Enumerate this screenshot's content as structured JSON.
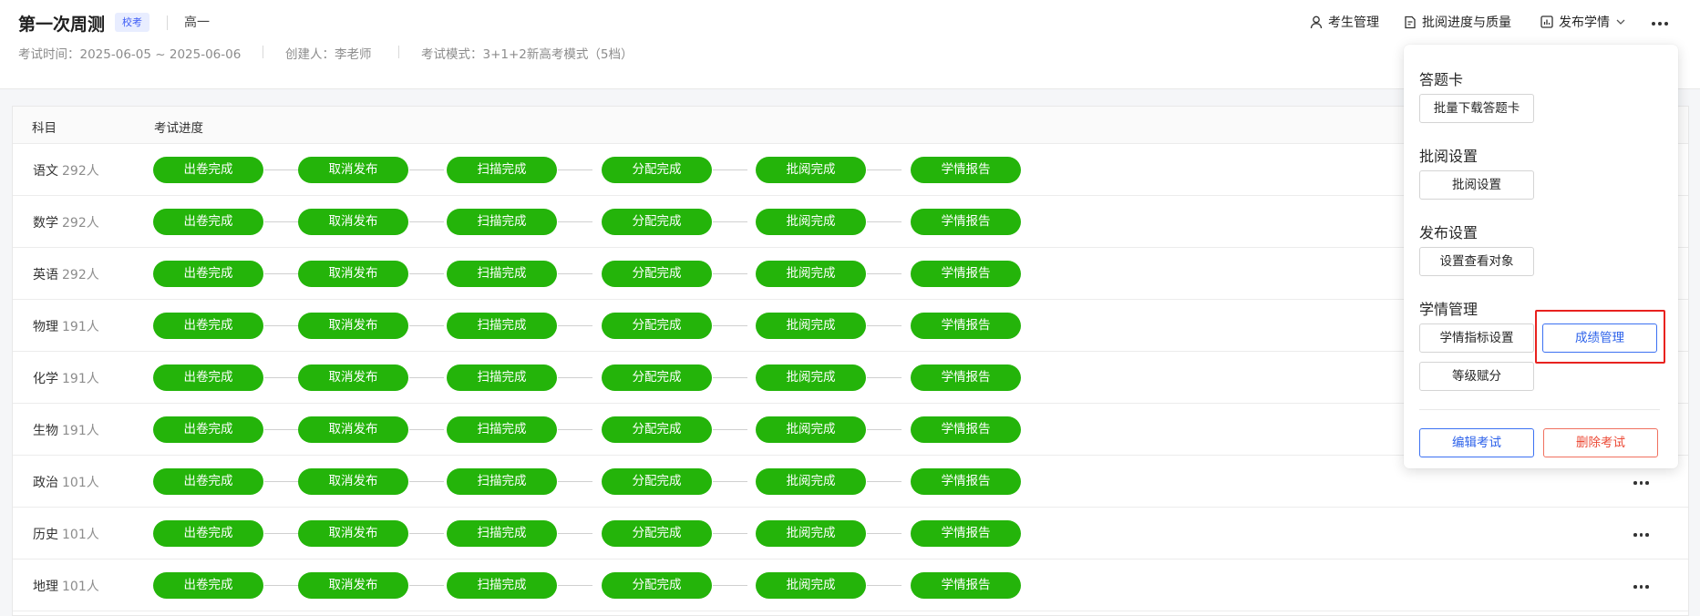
{
  "header": {
    "title": "第一次周测",
    "tag": "校考",
    "grade": "高一",
    "meta": {
      "exam_time": "考试时间：2025-06-05 ~ 2025-06-06",
      "creator": "创建人：李老师",
      "mode": "考试模式：3+1+2新高考模式（5档）"
    },
    "actions": {
      "student_mgmt": "考生管理",
      "review_progress": "批阅进度与质量",
      "publish_report": "发布学情"
    }
  },
  "table": {
    "columns": {
      "subject": "科目",
      "progress": "考试进度"
    },
    "stages": [
      "出卷完成",
      "取消发布",
      "扫描完成",
      "分配完成",
      "批阅完成",
      "学情报告"
    ],
    "rows": [
      {
        "subject": "语文",
        "count": "292人"
      },
      {
        "subject": "数学",
        "count": "292人"
      },
      {
        "subject": "英语",
        "count": "292人"
      },
      {
        "subject": "物理",
        "count": "191人"
      },
      {
        "subject": "化学",
        "count": "191人"
      },
      {
        "subject": "生物",
        "count": "191人"
      },
      {
        "subject": "政治",
        "count": "101人"
      },
      {
        "subject": "历史",
        "count": "101人"
      },
      {
        "subject": "地理",
        "count": "101人"
      }
    ]
  },
  "dropdown": {
    "answer_card": {
      "title": "答题卡",
      "batch_download": "批量下载答题卡"
    },
    "review": {
      "title": "批阅设置",
      "settings": "批阅设置"
    },
    "publish": {
      "title": "发布设置",
      "set_viewers": "设置查看对象"
    },
    "analytics": {
      "title": "学情管理",
      "indicator_settings": "学情指标设置",
      "score_mgmt": "成绩管理",
      "grade_assign": "等级赋分"
    },
    "edit_exam": "编辑考试",
    "delete_exam": "删除考试"
  },
  "colors": {
    "stage_green": "#24b40a",
    "primary_blue": "#2d62ea",
    "danger_red": "#ec4b37",
    "highlight_red": "#e8221f"
  },
  "icons": [
    "person-icon",
    "document-check-icon",
    "bar-chart-icon",
    "chevron-down-icon",
    "more-icon"
  ]
}
